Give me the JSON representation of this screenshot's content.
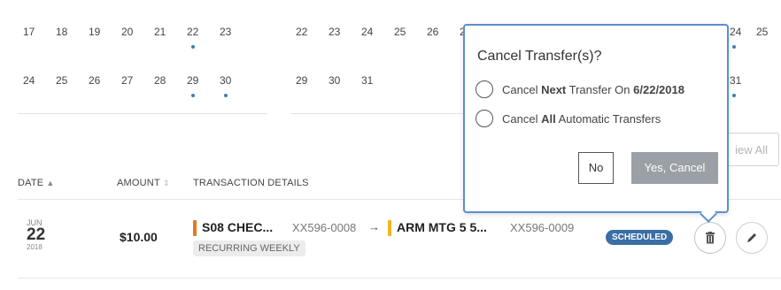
{
  "calendar": {
    "left_week1": [
      "17",
      "18",
      "19",
      "20",
      "21",
      "22",
      "23"
    ],
    "left_week2": [
      "24",
      "25",
      "26",
      "27",
      "28",
      "29",
      "30"
    ],
    "right_week1": [
      "22",
      "23",
      "24",
      "25",
      "26",
      "2"
    ],
    "right_week2": [
      "29",
      "30",
      "31"
    ],
    "far_right_week1": [
      "24",
      "25"
    ],
    "far_right_week2": [
      "31"
    ],
    "dot_color": "#3a7fb5"
  },
  "view_all_label": "iew All",
  "table": {
    "headers": {
      "date": "DATE",
      "amount": "AMOUNT",
      "details": "TRANSACTION DETAILS"
    },
    "row": {
      "date_month": "JUN",
      "date_day": "22",
      "date_year": "2018",
      "amount": "$10.00",
      "from_name": "S08 CHEC...",
      "from_number": "XX596-0008",
      "arrow": "→",
      "to_name": "ARM MTG 5 5...",
      "to_number": "XX596-0009",
      "recurrence": "RECURRING WEEKLY",
      "status": "SCHEDULED",
      "from_color": "#e07b1f",
      "to_color": "#f2b51c"
    }
  },
  "popover": {
    "title": "Cancel Transfer(s)?",
    "option_next": {
      "prefix": "Cancel ",
      "bold": "Next",
      "middle": " Transfer On ",
      "date": "6/22/2018"
    },
    "option_all": {
      "prefix": "Cancel ",
      "bold": "All",
      "suffix": " Automatic Transfers"
    },
    "no_label": "No",
    "yes_label": "Yes, Cancel",
    "border_color": "#5a8fcb"
  },
  "icons": {
    "sort": "sort-icon",
    "delete": "trash-icon",
    "edit": "pencil-icon"
  }
}
